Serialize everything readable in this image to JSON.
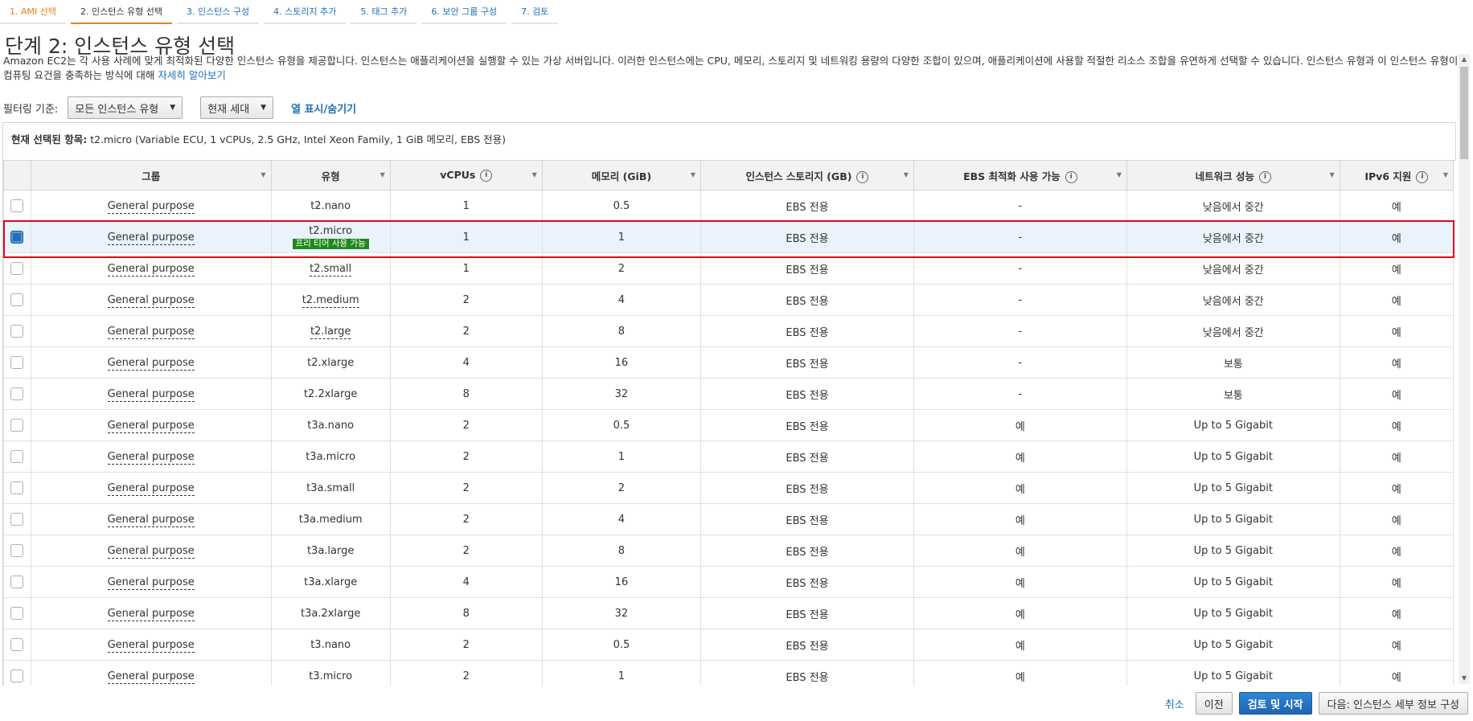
{
  "steps": [
    "1. AMI 선택",
    "2. 인스턴스 유형 선택",
    "3. 인스턴스 구성",
    "4. 스토리지 추가",
    "5. 태그 추가",
    "6. 보안 그룹 구성",
    "7. 검토"
  ],
  "title": "단계 2: 인스턴스 유형 선택",
  "description": "Amazon EC2는 각 사용 사례에 맞게 최적화된 다양한 인스턴스 유형을 제공합니다. 인스턴스는 애플리케이션을 실행할 수 있는 가상 서버입니다. 이러한 인스턴스에는 CPU, 메모리, 스토리지 및 네트워킹 용량의 다양한 조합이 있으며, 애플리케이션에 사용할 적절한 리소스 조합을 유연하게 선택할 수 있습니다. 인스턴스 유형과 이 인스턴스 유형이 컴퓨팅 요건을 충족하는 방식에 대해 ",
  "description_link": "자세히 알아보기",
  "filter": {
    "label": "필터링 기준:",
    "type_select": "모든 인스턴스 유형",
    "generation_select": "현재 세대",
    "columns_link": "열 표시/숨기기"
  },
  "selected": {
    "label": "현재 선택된 항목:",
    "value": "t2.micro (Variable ECU, 1 vCPUs, 2.5 GHz, Intel Xeon Family, 1 GiB 메모리, EBS 전용)"
  },
  "columns": [
    "그룹",
    "유형",
    "vCPUs",
    "메모리 (GiB)",
    "인스턴스 스토리지 (GB)",
    "EBS 최적화 사용 가능",
    "네트워크 성능",
    "IPv6 지원"
  ],
  "free_tier_badge": "프리 티어 사용 가능",
  "rows": [
    {
      "group": "General purpose",
      "type": "t2.nano",
      "vcpus": "1",
      "memory": "0.5",
      "storage": "EBS 전용",
      "ebs": "-",
      "network": "낮음에서 중간",
      "ipv6": "예"
    },
    {
      "group": "General purpose",
      "type": "t2.micro",
      "vcpus": "1",
      "memory": "1",
      "storage": "EBS 전용",
      "ebs": "-",
      "network": "낮음에서 중간",
      "ipv6": "예"
    },
    {
      "group": "General purpose",
      "type": "t2.small",
      "vcpus": "1",
      "memory": "2",
      "storage": "EBS 전용",
      "ebs": "-",
      "network": "낮음에서 중간",
      "ipv6": "예"
    },
    {
      "group": "General purpose",
      "type": "t2.medium",
      "vcpus": "2",
      "memory": "4",
      "storage": "EBS 전용",
      "ebs": "-",
      "network": "낮음에서 중간",
      "ipv6": "예"
    },
    {
      "group": "General purpose",
      "type": "t2.large",
      "vcpus": "2",
      "memory": "8",
      "storage": "EBS 전용",
      "ebs": "-",
      "network": "낮음에서 중간",
      "ipv6": "예"
    },
    {
      "group": "General purpose",
      "type": "t2.xlarge",
      "vcpus": "4",
      "memory": "16",
      "storage": "EBS 전용",
      "ebs": "-",
      "network": "보통",
      "ipv6": "예"
    },
    {
      "group": "General purpose",
      "type": "t2.2xlarge",
      "vcpus": "8",
      "memory": "32",
      "storage": "EBS 전용",
      "ebs": "-",
      "network": "보통",
      "ipv6": "예"
    },
    {
      "group": "General purpose",
      "type": "t3a.nano",
      "vcpus": "2",
      "memory": "0.5",
      "storage": "EBS 전용",
      "ebs": "예",
      "network": "Up to 5 Gigabit",
      "ipv6": "예"
    },
    {
      "group": "General purpose",
      "type": "t3a.micro",
      "vcpus": "2",
      "memory": "1",
      "storage": "EBS 전용",
      "ebs": "예",
      "network": "Up to 5 Gigabit",
      "ipv6": "예"
    },
    {
      "group": "General purpose",
      "type": "t3a.small",
      "vcpus": "2",
      "memory": "2",
      "storage": "EBS 전용",
      "ebs": "예",
      "network": "Up to 5 Gigabit",
      "ipv6": "예"
    },
    {
      "group": "General purpose",
      "type": "t3a.medium",
      "vcpus": "2",
      "memory": "4",
      "storage": "EBS 전용",
      "ebs": "예",
      "network": "Up to 5 Gigabit",
      "ipv6": "예"
    },
    {
      "group": "General purpose",
      "type": "t3a.large",
      "vcpus": "2",
      "memory": "8",
      "storage": "EBS 전용",
      "ebs": "예",
      "network": "Up to 5 Gigabit",
      "ipv6": "예"
    },
    {
      "group": "General purpose",
      "type": "t3a.xlarge",
      "vcpus": "4",
      "memory": "16",
      "storage": "EBS 전용",
      "ebs": "예",
      "network": "Up to 5 Gigabit",
      "ipv6": "예"
    },
    {
      "group": "General purpose",
      "type": "t3a.2xlarge",
      "vcpus": "8",
      "memory": "32",
      "storage": "EBS 전용",
      "ebs": "예",
      "network": "Up to 5 Gigabit",
      "ipv6": "예"
    },
    {
      "group": "General purpose",
      "type": "t3.nano",
      "vcpus": "2",
      "memory": "0.5",
      "storage": "EBS 전용",
      "ebs": "예",
      "network": "Up to 5 Gigabit",
      "ipv6": "예"
    },
    {
      "group": "General purpose",
      "type": "t3.micro",
      "vcpus": "2",
      "memory": "1",
      "storage": "EBS 전용",
      "ebs": "예",
      "network": "Up to 5 Gigabit",
      "ipv6": "예"
    }
  ],
  "footer": {
    "cancel": "취소",
    "previous": "이전",
    "review_launch": "검토 및 시작",
    "next": "다음: 인스턴스 세부 정보 구성"
  },
  "colors": {
    "accent_orange": "#e7811d",
    "link_blue": "#1f6fb8",
    "primary_blue": "#1d64b0",
    "free_tier_green": "#1e8a1e",
    "highlight_red": "#e30613"
  }
}
